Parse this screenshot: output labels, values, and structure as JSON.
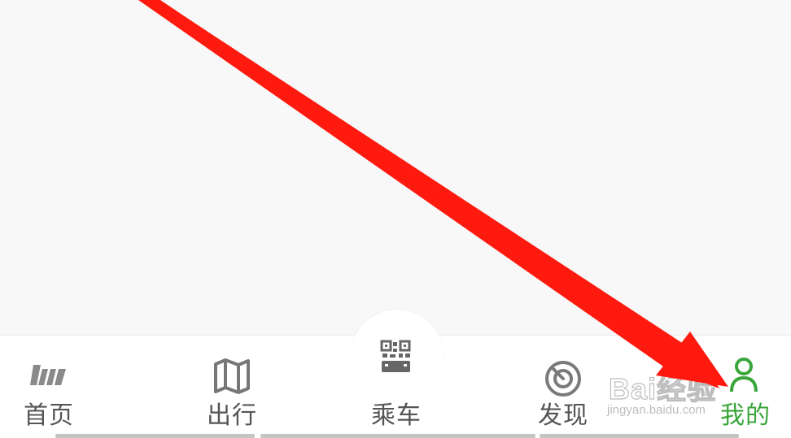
{
  "tabbar": {
    "tabs": [
      {
        "label": "首页",
        "icon": "home-logo-icon",
        "active": false
      },
      {
        "label": "出行",
        "icon": "map-icon",
        "active": false
      },
      {
        "label": "乘车",
        "icon": "qr-bus-icon",
        "active": false
      },
      {
        "label": "发现",
        "icon": "radar-icon",
        "active": false
      },
      {
        "label": "我的",
        "icon": "person-icon",
        "active": true
      }
    ]
  },
  "colors": {
    "active": "#3aa63a",
    "inactive": "#555555",
    "annotation_arrow": "#ff1a0f"
  },
  "watermark": {
    "brand": "Bai经验",
    "url": "jingyan.baidu.com"
  }
}
